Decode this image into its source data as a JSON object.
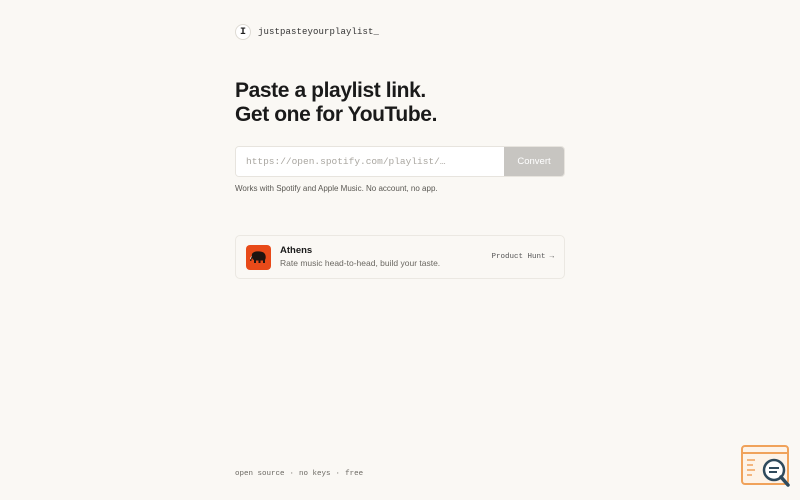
{
  "header": {
    "logo_glyph": "I",
    "site_name": "justpasteyourplaylist_"
  },
  "hero": {
    "line1": "Paste a playlist link.",
    "line2": "Get one for YouTube."
  },
  "form": {
    "placeholder": "https://open.spotify.com/playlist/…",
    "value": "",
    "convert_label": "Convert"
  },
  "helper_text": "Works with Spotify and Apple Music. No account, no app.",
  "promo": {
    "title": "Athens",
    "description": "Rate music head-to-head, build your taste.",
    "link_label": "Product Hunt",
    "link_arrow": "→",
    "icon": "mammoth-icon",
    "icon_bg": "#e84a19"
  },
  "footer": {
    "items": [
      "open source",
      "no keys",
      "free"
    ],
    "separator": "·"
  },
  "colors": {
    "background": "#faf8f4",
    "button_disabled": "#c7c5c1",
    "widget_accent": "#f0a25a"
  }
}
